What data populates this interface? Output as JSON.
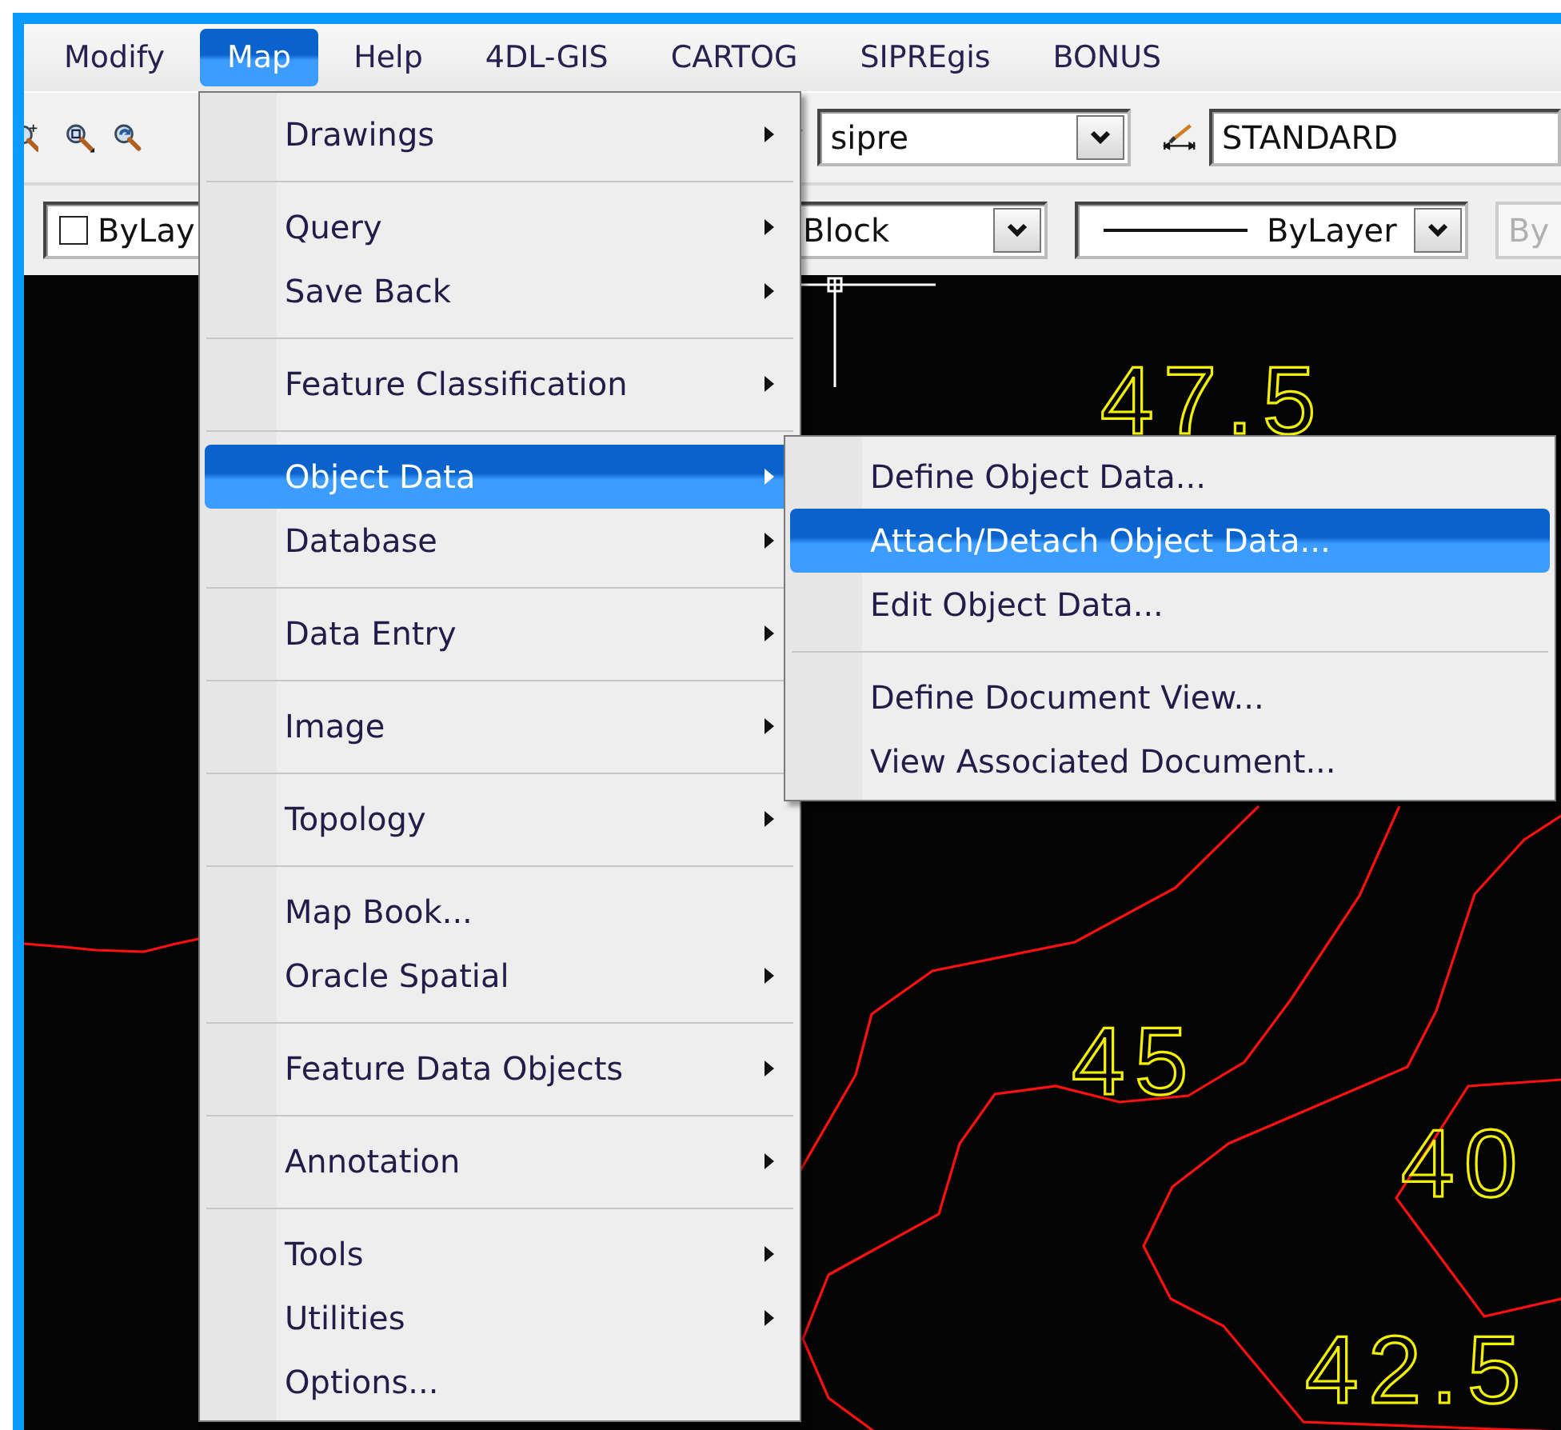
{
  "menu_bar": [
    {
      "label": "Modify",
      "selected": false
    },
    {
      "label": "Map",
      "selected": true
    },
    {
      "label": "Help",
      "selected": false
    },
    {
      "label": "4DL-GIS",
      "selected": false
    },
    {
      "label": "CARTOG",
      "selected": false
    },
    {
      "label": "SIPREgis",
      "selected": false
    },
    {
      "label": "BONUS",
      "selected": false
    }
  ],
  "styles_toolbar": {
    "text_style": {
      "value": "sipre"
    },
    "dimension_style": {
      "value": "STANDARD"
    }
  },
  "properties_toolbar": {
    "color": {
      "value": "ByLay",
      "disabled": false
    },
    "layer": {
      "value": "Block",
      "disabled": false
    },
    "linetype": {
      "value": "ByLayer",
      "disabled": false
    },
    "lineweight": {
      "value": "By",
      "disabled": true
    }
  },
  "map_menu": {
    "sections": [
      [
        {
          "label": "Drawings",
          "submenu": true,
          "selected": false
        }
      ],
      [
        {
          "label": "Query",
          "submenu": true,
          "selected": false
        },
        {
          "label": "Save Back",
          "submenu": true,
          "selected": false
        }
      ],
      [
        {
          "label": "Feature Classification",
          "submenu": true,
          "selected": false
        }
      ],
      [
        {
          "label": "Object Data",
          "submenu": true,
          "selected": true
        },
        {
          "label": "Database",
          "submenu": true,
          "selected": false
        }
      ],
      [
        {
          "label": "Data Entry",
          "submenu": true,
          "selected": false
        }
      ],
      [
        {
          "label": "Image",
          "submenu": true,
          "selected": false
        }
      ],
      [
        {
          "label": "Topology",
          "submenu": true,
          "selected": false
        }
      ],
      [
        {
          "label": "Map Book...",
          "submenu": false,
          "selected": false
        },
        {
          "label": "Oracle Spatial",
          "submenu": true,
          "selected": false
        }
      ],
      [
        {
          "label": "Feature Data Objects",
          "submenu": true,
          "selected": false
        }
      ],
      [
        {
          "label": "Annotation",
          "submenu": true,
          "selected": false
        }
      ],
      [
        {
          "label": "Tools",
          "submenu": true,
          "selected": false
        },
        {
          "label": "Utilities",
          "submenu": true,
          "selected": false
        },
        {
          "label": "Options...",
          "submenu": false,
          "selected": false
        }
      ]
    ]
  },
  "object_data_submenu": {
    "sections": [
      [
        {
          "label": "Define Object Data...",
          "submenu": false,
          "selected": false
        },
        {
          "label": "Attach/Detach Object Data...",
          "submenu": false,
          "selected": true
        },
        {
          "label": "Edit Object Data...",
          "submenu": false,
          "selected": false
        }
      ],
      [
        {
          "label": "Define Document View...",
          "submenu": false,
          "selected": false
        },
        {
          "label": "View Associated Document...",
          "submenu": false,
          "selected": false
        }
      ]
    ]
  },
  "drawing": {
    "contour_labels": [
      {
        "text": "47.5"
      },
      {
        "text": "45"
      },
      {
        "text": "40"
      },
      {
        "text": "42.5"
      }
    ]
  }
}
